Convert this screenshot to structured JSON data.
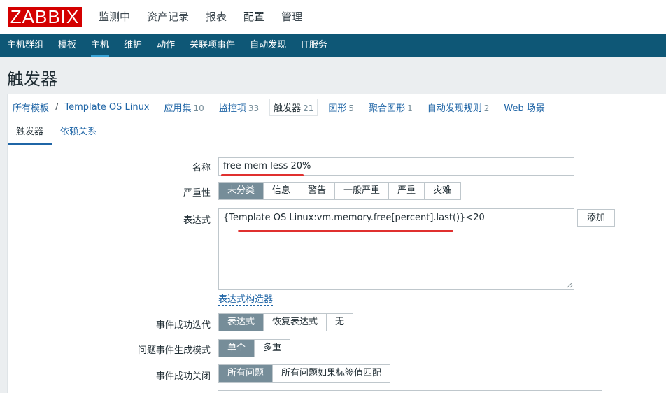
{
  "logo": "ZABBIX",
  "main_menu": [
    "监测中",
    "资产记录",
    "报表",
    "配置",
    "管理"
  ],
  "sub_nav": [
    "主机群组",
    "模板",
    "主机",
    "维护",
    "动作",
    "关联项事件",
    "自动发现",
    "IT服务"
  ],
  "page_title": "触发器",
  "breadcrumb": {
    "all_templates": "所有模板",
    "separator": "/",
    "template": "Template OS Linux",
    "items": [
      {
        "label": "应用集",
        "count": "10"
      },
      {
        "label": "监控项",
        "count": "33"
      },
      {
        "label": "触发器",
        "count": "21"
      },
      {
        "label": "图形",
        "count": "5"
      },
      {
        "label": "聚合图形",
        "count": "1"
      },
      {
        "label": "自动发现规则",
        "count": "2"
      },
      {
        "label": "Web 场景",
        "count": ""
      }
    ]
  },
  "tabs": [
    "触发器",
    "依赖关系"
  ],
  "form": {
    "name_label": "名称",
    "name_value": "free mem less 20%",
    "severity_label": "严重性",
    "severity_options": [
      "未分类",
      "信息",
      "警告",
      "一般严重",
      "严重",
      "灾难"
    ],
    "expression_label": "表达式",
    "expression_value": "{Template OS Linux:vm.memory.free[percent].last()}<20",
    "add_button": "添加",
    "expression_builder_link": "表达式构造器",
    "ok_event_gen_label": "事件成功迭代",
    "ok_event_gen_options": [
      "表达式",
      "恢复表达式",
      "无"
    ],
    "problem_mode_label": "问题事件生成模式",
    "problem_mode_options": [
      "单个",
      "多重"
    ],
    "ok_close_label": "事件成功关闭",
    "ok_close_options": [
      "所有问题",
      "所有问题如果标签值匹配"
    ]
  },
  "colors": {
    "logo_red": "#d40000",
    "nav_blue": "#0e5776",
    "link_blue": "#1f65a6",
    "selected_gray": "#768d99",
    "annotation_red": "#e0302f"
  }
}
